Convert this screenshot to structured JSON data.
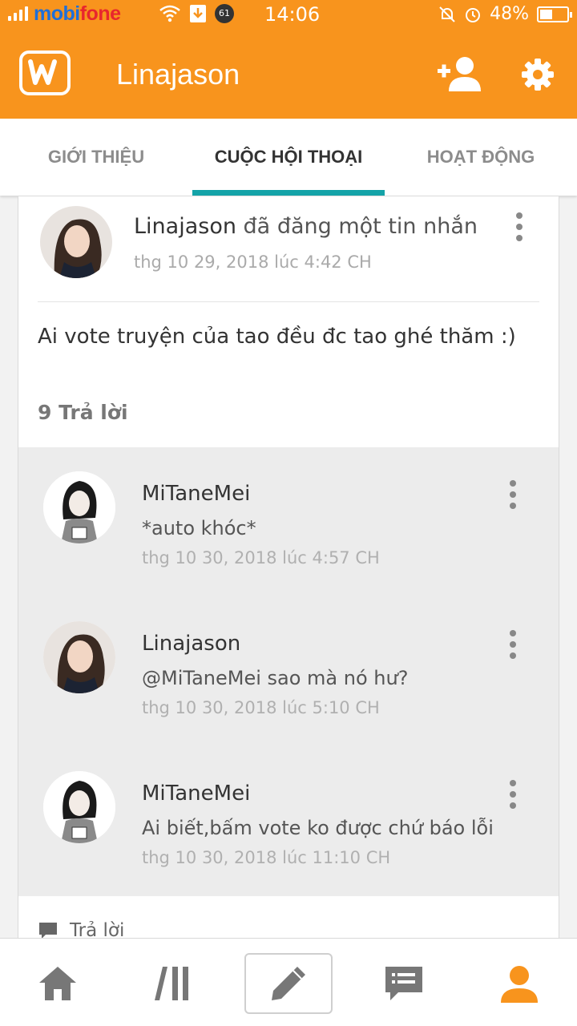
{
  "status_bar": {
    "carrier": "mobifone",
    "notification_count": "61",
    "time": "14:06",
    "battery": "48%",
    "battery_level": 0.48
  },
  "app_bar": {
    "title": "Linajason",
    "color": "#f8941d"
  },
  "tabs": [
    {
      "label": "GIỚI THIỆU",
      "active": false
    },
    {
      "label": "CUỘC HỘI THOẠI",
      "active": true
    },
    {
      "label": "HOẠT ĐỘNG",
      "active": false
    }
  ],
  "post": {
    "author": "Linajason",
    "action": "đã đăng một tin nhắn",
    "timestamp": "thg 10 29, 2018 lúc 4:42 CH",
    "body": "Ai vote truyện của tao đều đc tao ghé thăm :)",
    "reply_count_label": "9 Trả lời"
  },
  "replies": [
    {
      "author": "MiTaneMei",
      "text": "*auto khóc*",
      "timestamp": "thg 10 30, 2018 lúc 4:57 CH"
    },
    {
      "author": "Linajason",
      "text": "@MiTaneMei sao mà nó hư?",
      "timestamp": "thg 10 30, 2018 lúc 5:10 CH"
    },
    {
      "author": "MiTaneMei",
      "text": "Ai biết,bấm vote ko được chứ báo lỗi",
      "timestamp": "thg 10 30, 2018 lúc 11:10 CH"
    }
  ],
  "reply_action_label": "Trả lời",
  "bottom_nav": [
    {
      "icon": "home-icon",
      "active": false
    },
    {
      "icon": "library-icon",
      "active": false
    },
    {
      "icon": "write-icon",
      "active": false
    },
    {
      "icon": "messages-icon",
      "active": false
    },
    {
      "icon": "profile-icon",
      "active": true
    }
  ],
  "colors": {
    "accent": "#f8941d",
    "tab_indicator": "#14a3a8"
  }
}
